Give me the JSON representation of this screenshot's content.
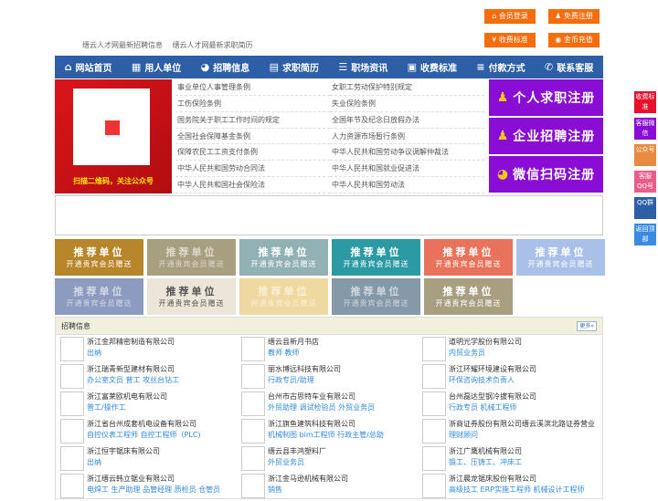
{
  "top_buttons": [
    {
      "label": "会员登录",
      "icon": "home-icon",
      "glyph": "⌂"
    },
    {
      "label": "免费注册",
      "icon": "user-icon",
      "glyph": "♟"
    },
    {
      "label": "收费标准",
      "icon": "yen-icon",
      "glyph": "¥"
    },
    {
      "label": "金币充值",
      "icon": "coins-icon",
      "glyph": "◉"
    }
  ],
  "subtitle": [
    "缙云人才网最新招聘信息",
    "缙云人才网最新求职简历"
  ],
  "nav": [
    {
      "label": "网站首页",
      "glyph": "⌂"
    },
    {
      "label": "用人单位",
      "glyph": "▦"
    },
    {
      "label": "招聘信息",
      "glyph": "◕"
    },
    {
      "label": "求职简历",
      "glyph": "▤"
    },
    {
      "label": "职场资讯",
      "glyph": "☰"
    },
    {
      "label": "收费标准",
      "glyph": "▣"
    },
    {
      "label": "付款方式",
      "glyph": "≡"
    },
    {
      "label": "联系客服",
      "glyph": "✆"
    }
  ],
  "qr_caption": "扫描二维码，关注公众号",
  "laws": [
    "事业单位人事管理条例",
    "女职工劳动保护特别规定",
    "工伤保险条例",
    "失业保险条例",
    "国务院关于职工工作时间的规定",
    "全国年节及纪念日放假办法",
    "全国社会保障基金条例",
    "人力资源市场暂行条例",
    "保障农民工工资支付条例",
    "中华人民共和国劳动争议调解仲裁法",
    "中华人民共和国劳动合同法",
    "中华人民共和国就业促进法",
    "中华人民共和国社会保险法",
    "中华人民共和国劳动法"
  ],
  "register": [
    {
      "label": "个人求职注册",
      "glyph": "♟"
    },
    {
      "label": "企业招聘注册",
      "glyph": "♟"
    },
    {
      "label": "微信扫码注册",
      "glyph": "◕"
    }
  ],
  "tiles": {
    "title": "推荐单位",
    "sub": "开通贵宾会员赠送",
    "colors": [
      "#b8862a",
      "#a89f80",
      "#92b1b5",
      "#2c9aa3",
      "#e8735a",
      "#a9c0e8",
      "#8e9bc0",
      "#ece6d8",
      "#f0d9a0",
      "#8599a8",
      "#a89f80"
    ]
  },
  "recruit": {
    "title": "招聘信息",
    "more": "更多»",
    "items": [
      {
        "company": "浙江金邦精密制造有限公司",
        "jobs": "出纳"
      },
      {
        "company": "缙云县新月书店",
        "jobs": "教师 教师"
      },
      {
        "company": "道明光学股份有限公司",
        "jobs": "内贸业务员"
      },
      {
        "company": "浙江瑞青新型建材有限公司",
        "jobs": "办公室文员 普工 攻丝台钻工"
      },
      {
        "company": "丽水博远科技有限公司",
        "jobs": "行政专员/助理"
      },
      {
        "company": "浙江环耀环境建设有限公司",
        "jobs": "环保咨询技术负责人"
      },
      {
        "company": "浙江富莱欧机电有限公司",
        "jobs": "普工/操作工"
      },
      {
        "company": "台州市古思特车业有限公司",
        "jobs": "外贸助理 调试检验员 外贸业务员"
      },
      {
        "company": "台州磊达型钢冷拔有限公司",
        "jobs": "行政专员 机械工程师"
      },
      {
        "company": "浙江省台州成套机电设备有限公司",
        "jobs": "自控仪表工程师 自控工程师（PLC)"
      },
      {
        "company": "浙江旗鱼建筑科技有限公司",
        "jobs": "机械制图 bim工程师 行政主管/总助"
      },
      {
        "company": "浙商证券股份有限公司缙云溪滨北路证券营业",
        "jobs": "理财顾问"
      },
      {
        "company": "浙江恒宇锯床有限公司",
        "jobs": "出纳"
      },
      {
        "company": "缙云县丰鸿塑料厂",
        "jobs": "外贸业务员"
      },
      {
        "company": "浙江广鹰机械有限公司",
        "jobs": "锻工、压铸工、冲床工"
      },
      {
        "company": "浙江缙云韩立锯业有限公司",
        "jobs": "电焊工 生产助理 品管经理 质检员 仓管员"
      },
      {
        "company": "浙江金马逊机械有限公司",
        "jobs": "销售"
      },
      {
        "company": "浙江晨龙锯床股份有限公司",
        "jobs": "高级技工 ERP实施工程师 机械设计工程师"
      }
    ]
  },
  "side": [
    {
      "label": "收费标准",
      "color": "#e8102a"
    },
    {
      "label": "客服微信",
      "color": "#8a0dd6"
    },
    {
      "label": "公众号",
      "color": "#e88a40"
    },
    {
      "label": "客服QQ号",
      "color": "#e85d8a"
    },
    {
      "label": "QQ群",
      "color": "#2d5fa6"
    },
    {
      "label": "返回顶部",
      "color": "#3a8be0"
    }
  ]
}
